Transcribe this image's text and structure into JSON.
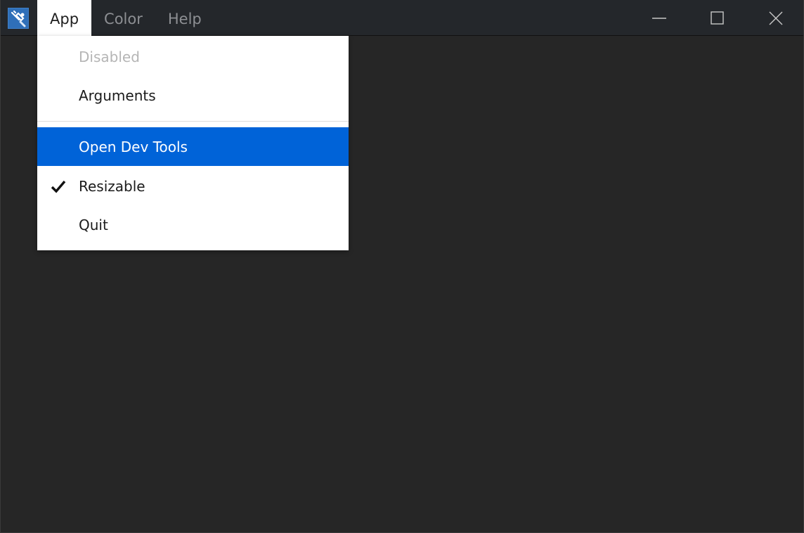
{
  "menubar": {
    "items": [
      {
        "label": "App",
        "active": true
      },
      {
        "label": "Color",
        "active": false
      },
      {
        "label": "Help",
        "active": false
      }
    ]
  },
  "app_menu": {
    "items": [
      {
        "label": "Disabled",
        "disabled": true
      },
      {
        "label": "Arguments",
        "disabled": false
      },
      {
        "label": "Open Dev Tools",
        "highlighted": true
      },
      {
        "label": "Resizable",
        "checked": true
      },
      {
        "label": "Quit",
        "disabled": false
      }
    ]
  },
  "colors": {
    "background": "#262626",
    "titlebar": "#24272b",
    "highlight": "#0063d8",
    "menu_text_inactive": "#8d8f93",
    "disabled_text": "#b5b5b5"
  },
  "icons": {
    "app": "app-icon",
    "minimize": "minimize-icon",
    "maximize": "maximize-icon",
    "close": "close-icon",
    "check": "checkmark-icon"
  }
}
